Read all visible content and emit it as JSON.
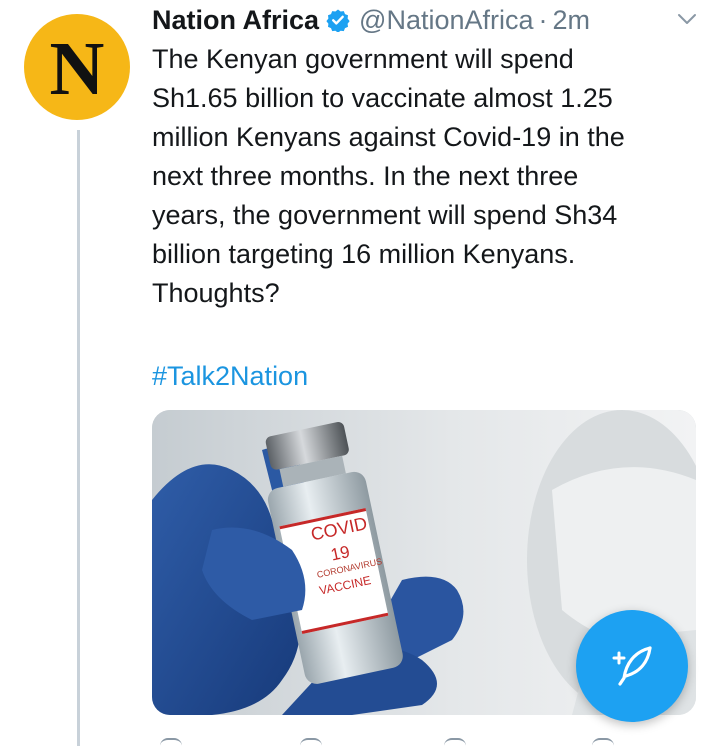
{
  "tweet": {
    "avatar_letter": "N",
    "display_name": "Nation Africa",
    "handle": "@NationAfrica",
    "separator": "·",
    "time": "2m",
    "text": "The Kenyan government will spend\nSh1.65 billion to vaccinate almost 1.25\nmillion Kenyans against Covid-19 in the\nnext three months. In the next three\nyears, the government will spend Sh34\nbillion targeting 16 million Kenyans.\nThoughts?",
    "hashtag": "#Talk2Nation",
    "media": {
      "label_line1": "COVID",
      "label_line2": "19",
      "label_line3": "CORONAVIRUS",
      "label_line4": "VACCINE"
    }
  },
  "icons": {
    "verified": "verified-badge-icon",
    "menu": "chevron-down-icon",
    "compose": "feather-plus-icon"
  },
  "colors": {
    "accent": "#1da1f2",
    "link": "#1b95e0",
    "avatar_bg": "#f6b717",
    "text": "#14171a",
    "muted": "#657786"
  }
}
